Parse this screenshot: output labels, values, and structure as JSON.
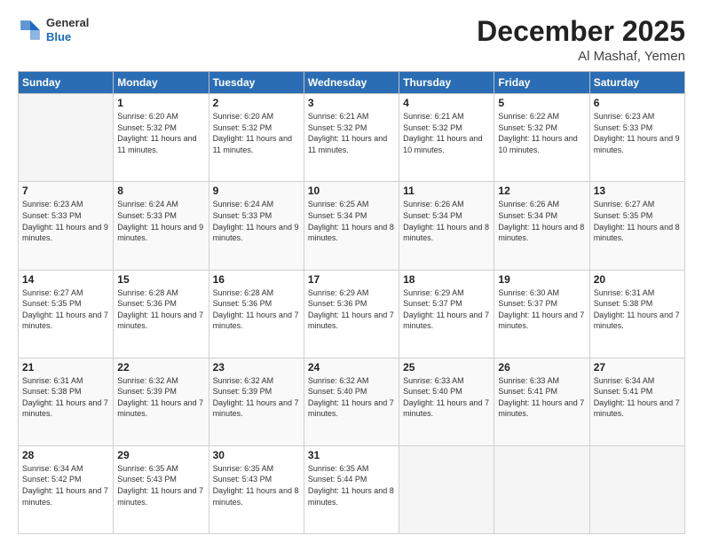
{
  "header": {
    "logo_general": "General",
    "logo_blue": "Blue",
    "month_title": "December 2025",
    "location": "Al Mashaf, Yemen"
  },
  "weekdays": [
    "Sunday",
    "Monday",
    "Tuesday",
    "Wednesday",
    "Thursday",
    "Friday",
    "Saturday"
  ],
  "weeks": [
    [
      {
        "day": "",
        "sunrise": "",
        "sunset": "",
        "daylight": ""
      },
      {
        "day": "1",
        "sunrise": "6:20 AM",
        "sunset": "5:32 PM",
        "daylight": "11 hours and 11 minutes."
      },
      {
        "day": "2",
        "sunrise": "6:20 AM",
        "sunset": "5:32 PM",
        "daylight": "11 hours and 11 minutes."
      },
      {
        "day": "3",
        "sunrise": "6:21 AM",
        "sunset": "5:32 PM",
        "daylight": "11 hours and 11 minutes."
      },
      {
        "day": "4",
        "sunrise": "6:21 AM",
        "sunset": "5:32 PM",
        "daylight": "11 hours and 10 minutes."
      },
      {
        "day": "5",
        "sunrise": "6:22 AM",
        "sunset": "5:32 PM",
        "daylight": "11 hours and 10 minutes."
      },
      {
        "day": "6",
        "sunrise": "6:23 AM",
        "sunset": "5:33 PM",
        "daylight": "11 hours and 9 minutes."
      }
    ],
    [
      {
        "day": "7",
        "sunrise": "6:23 AM",
        "sunset": "5:33 PM",
        "daylight": "11 hours and 9 minutes."
      },
      {
        "day": "8",
        "sunrise": "6:24 AM",
        "sunset": "5:33 PM",
        "daylight": "11 hours and 9 minutes."
      },
      {
        "day": "9",
        "sunrise": "6:24 AM",
        "sunset": "5:33 PM",
        "daylight": "11 hours and 9 minutes."
      },
      {
        "day": "10",
        "sunrise": "6:25 AM",
        "sunset": "5:34 PM",
        "daylight": "11 hours and 8 minutes."
      },
      {
        "day": "11",
        "sunrise": "6:26 AM",
        "sunset": "5:34 PM",
        "daylight": "11 hours and 8 minutes."
      },
      {
        "day": "12",
        "sunrise": "6:26 AM",
        "sunset": "5:34 PM",
        "daylight": "11 hours and 8 minutes."
      },
      {
        "day": "13",
        "sunrise": "6:27 AM",
        "sunset": "5:35 PM",
        "daylight": "11 hours and 8 minutes."
      }
    ],
    [
      {
        "day": "14",
        "sunrise": "6:27 AM",
        "sunset": "5:35 PM",
        "daylight": "11 hours and 7 minutes."
      },
      {
        "day": "15",
        "sunrise": "6:28 AM",
        "sunset": "5:36 PM",
        "daylight": "11 hours and 7 minutes."
      },
      {
        "day": "16",
        "sunrise": "6:28 AM",
        "sunset": "5:36 PM",
        "daylight": "11 hours and 7 minutes."
      },
      {
        "day": "17",
        "sunrise": "6:29 AM",
        "sunset": "5:36 PM",
        "daylight": "11 hours and 7 minutes."
      },
      {
        "day": "18",
        "sunrise": "6:29 AM",
        "sunset": "5:37 PM",
        "daylight": "11 hours and 7 minutes."
      },
      {
        "day": "19",
        "sunrise": "6:30 AM",
        "sunset": "5:37 PM",
        "daylight": "11 hours and 7 minutes."
      },
      {
        "day": "20",
        "sunrise": "6:31 AM",
        "sunset": "5:38 PM",
        "daylight": "11 hours and 7 minutes."
      }
    ],
    [
      {
        "day": "21",
        "sunrise": "6:31 AM",
        "sunset": "5:38 PM",
        "daylight": "11 hours and 7 minutes."
      },
      {
        "day": "22",
        "sunrise": "6:32 AM",
        "sunset": "5:39 PM",
        "daylight": "11 hours and 7 minutes."
      },
      {
        "day": "23",
        "sunrise": "6:32 AM",
        "sunset": "5:39 PM",
        "daylight": "11 hours and 7 minutes."
      },
      {
        "day": "24",
        "sunrise": "6:32 AM",
        "sunset": "5:40 PM",
        "daylight": "11 hours and 7 minutes."
      },
      {
        "day": "25",
        "sunrise": "6:33 AM",
        "sunset": "5:40 PM",
        "daylight": "11 hours and 7 minutes."
      },
      {
        "day": "26",
        "sunrise": "6:33 AM",
        "sunset": "5:41 PM",
        "daylight": "11 hours and 7 minutes."
      },
      {
        "day": "27",
        "sunrise": "6:34 AM",
        "sunset": "5:41 PM",
        "daylight": "11 hours and 7 minutes."
      }
    ],
    [
      {
        "day": "28",
        "sunrise": "6:34 AM",
        "sunset": "5:42 PM",
        "daylight": "11 hours and 7 minutes."
      },
      {
        "day": "29",
        "sunrise": "6:35 AM",
        "sunset": "5:43 PM",
        "daylight": "11 hours and 7 minutes."
      },
      {
        "day": "30",
        "sunrise": "6:35 AM",
        "sunset": "5:43 PM",
        "daylight": "11 hours and 8 minutes."
      },
      {
        "day": "31",
        "sunrise": "6:35 AM",
        "sunset": "5:44 PM",
        "daylight": "11 hours and 8 minutes."
      },
      {
        "day": "",
        "sunrise": "",
        "sunset": "",
        "daylight": ""
      },
      {
        "day": "",
        "sunrise": "",
        "sunset": "",
        "daylight": ""
      },
      {
        "day": "",
        "sunrise": "",
        "sunset": "",
        "daylight": ""
      }
    ]
  ]
}
